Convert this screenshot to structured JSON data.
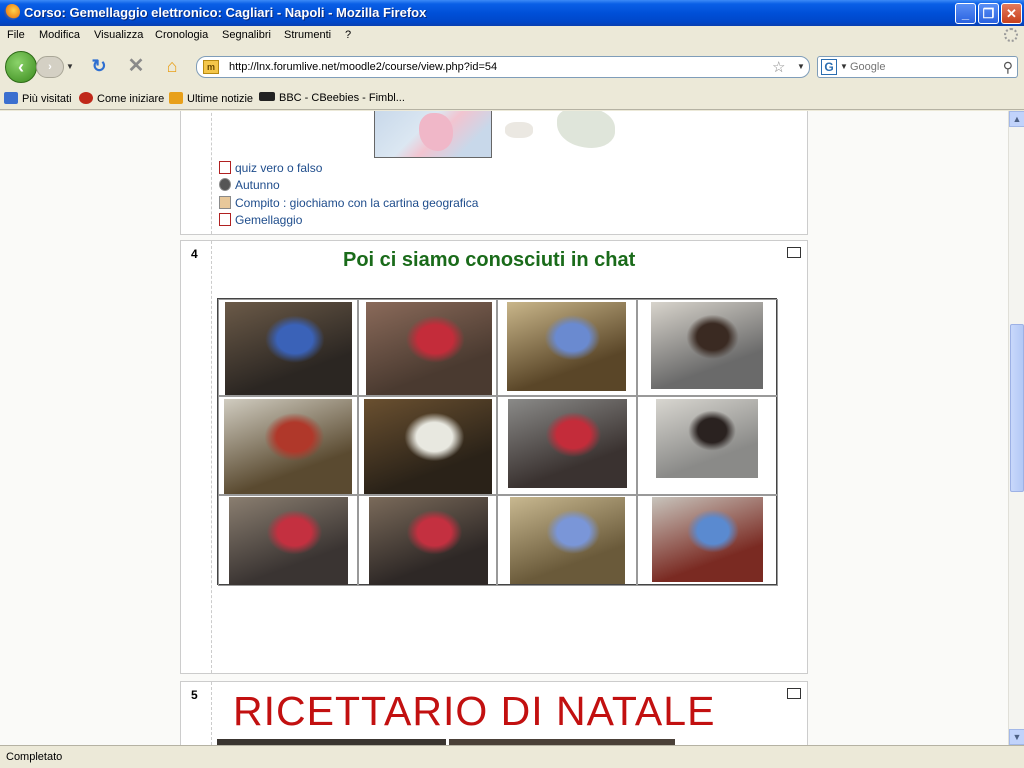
{
  "window": {
    "title": "Corso: Gemellaggio elettronico: Cagliari - Napoli - Mozilla Firefox",
    "buttons": {
      "minimize": "_",
      "restore": "❐",
      "close": "✕"
    }
  },
  "menu": {
    "items": [
      {
        "label": "File"
      },
      {
        "label": "Modifica"
      },
      {
        "label": "Visualizza"
      },
      {
        "label": "Cronologia"
      },
      {
        "label": "Segnalibri"
      },
      {
        "label": "Strumenti"
      },
      {
        "label": "?"
      }
    ]
  },
  "navigation": {
    "url": "http://lnx.forumlive.net/moodle2/course/view.php?id=54",
    "search_placeholder": "Google",
    "search_engine_icon": "google-icon"
  },
  "bookmarks": {
    "items": [
      {
        "label": "Più visitati",
        "icon": "most-visited-icon",
        "color": "#3b6fcf"
      },
      {
        "label": "Come iniziare",
        "icon": "firefox-red-icon",
        "color": "#c0281a"
      },
      {
        "label": "Ultime notizie",
        "icon": "rss-feed-icon",
        "color": "#e8a01a"
      },
      {
        "label": "BBC - CBeebies - Fimbl...",
        "icon": "bbc-icon",
        "color": "#222222"
      }
    ]
  },
  "course": {
    "section3": {
      "resources": [
        {
          "label": "quiz vero o falso",
          "icon": "quiz-icon"
        },
        {
          "label": "Autunno",
          "icon": "audio-resource-icon"
        },
        {
          "label": "Compito : giochiamo con la cartina geografica",
          "icon": "assignment-icon"
        },
        {
          "label": "Gemellaggio",
          "icon": "quiz-icon"
        }
      ]
    },
    "section4": {
      "number": "4",
      "heading": "Poi ci siamo conosciuti in chat",
      "heading_color": "#1a6b1a",
      "photos": [
        {
          "name": "photo-girl-at-computer"
        },
        {
          "name": "photo-teacher-with-children"
        },
        {
          "name": "photo-monitor-with-chat"
        },
        {
          "name": "photo-children-in-lab"
        },
        {
          "name": "photo-monitor-closeup"
        },
        {
          "name": "photo-boy-at-monitor"
        },
        {
          "name": "photo-children-at-computers"
        },
        {
          "name": "photo-teacher-helping-child"
        },
        {
          "name": "photo-lab-corridor"
        },
        {
          "name": "photo-children-in-row"
        },
        {
          "name": "photo-monitor-on-desk"
        },
        {
          "name": "photo-monitor-ciao"
        }
      ]
    },
    "section5": {
      "number": "5",
      "heading": "RICETTARIO DI NATALE",
      "heading_color": "#c21010"
    }
  },
  "status": {
    "text": "Completato"
  }
}
